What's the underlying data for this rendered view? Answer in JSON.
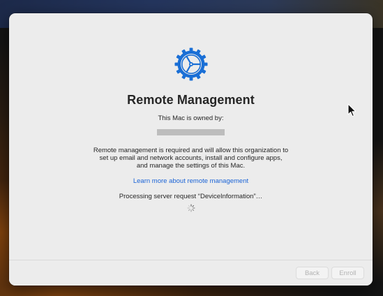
{
  "window": {
    "title": "Remote Management",
    "owned_label": "This Mac is owned by:",
    "description": "Remote management is required and will allow this organization to set up email and network accounts, install and configure apps, and manage the settings of this Mac.",
    "learn_more_link": "Learn more about remote management",
    "status": "Processing server request “DeviceInformation”…"
  },
  "icons": {
    "main": "gear-icon",
    "spinner": "progress-spinner-icon",
    "cursor": "mouse-pointer-icon"
  },
  "footer": {
    "back_label": "Back",
    "enroll_label": "Enroll"
  },
  "colors": {
    "accent": "#1a6fd6",
    "link": "#1a63d6",
    "window_bg": "#ececec",
    "disabled_text": "#b2b2b2"
  }
}
